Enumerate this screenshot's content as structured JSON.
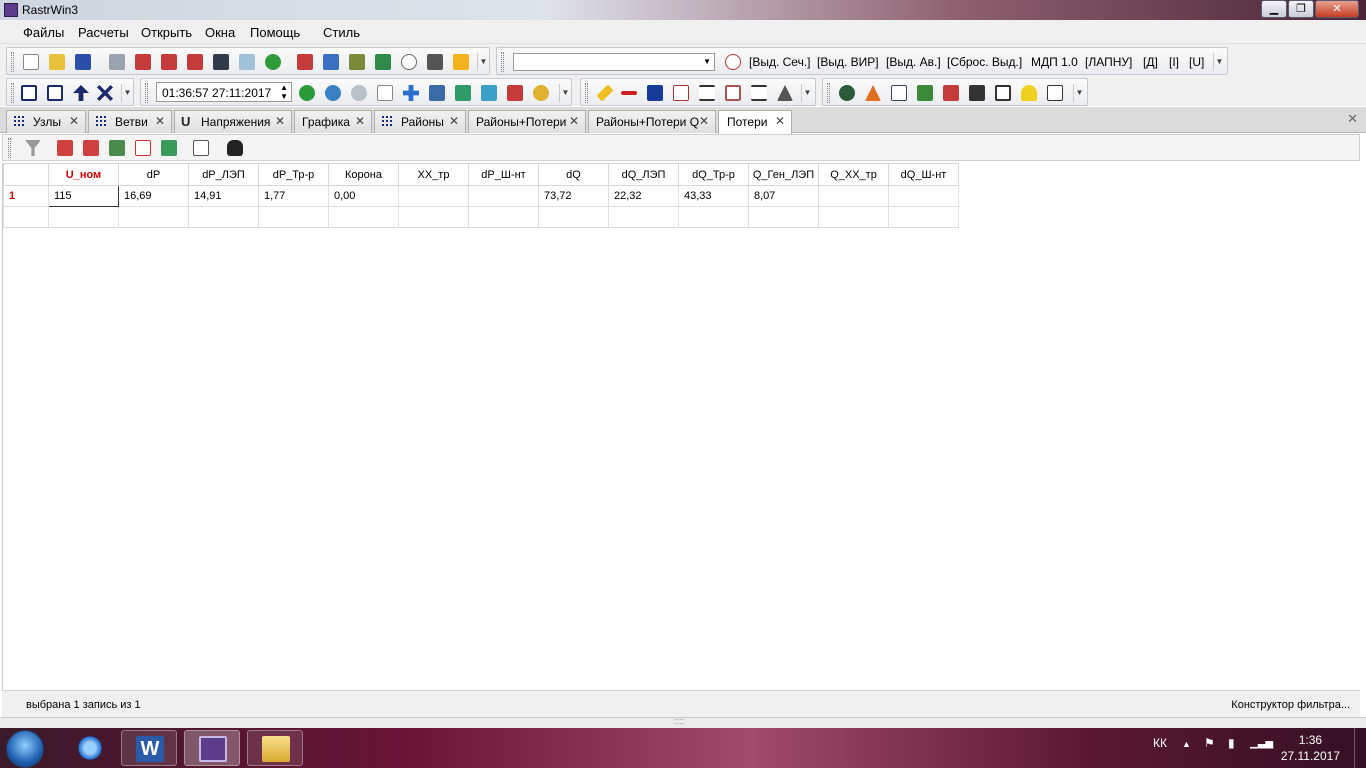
{
  "window": {
    "title": "RastrWin3"
  },
  "menu": [
    "Файлы",
    "Расчеты",
    "Открыть",
    "Окна",
    "Помощь",
    "Стиль"
  ],
  "toolbar1": {
    "combo_value": "",
    "text_buttons": [
      "[Выд. Сеч.]",
      "[Выд. ВИР]",
      "[Выд. Ав.]",
      "[Сброс. Выд.]",
      "МДП 1.0",
      "[ЛАПНУ]",
      "[Д]",
      "[I]",
      "[U]"
    ]
  },
  "toolbar2": {
    "datetime": "01:36:57  27:11:2017"
  },
  "tabs": [
    {
      "label": "Узлы",
      "icon": "grid-icon",
      "active": false
    },
    {
      "label": "Ветви",
      "icon": "branch-icon",
      "active": false
    },
    {
      "label": "Напряжения",
      "icon": "voltage-icon",
      "active": false
    },
    {
      "label": "Графика",
      "icon": "",
      "active": false
    },
    {
      "label": "Районы",
      "icon": "grid-icon",
      "active": false
    },
    {
      "label": "Районы+Потери",
      "icon": "",
      "active": false
    },
    {
      "label": "Районы+Потери Q",
      "icon": "",
      "active": false
    },
    {
      "label": "Потери",
      "icon": "",
      "active": true
    }
  ],
  "table": {
    "columns": [
      "U_ном",
      "dP",
      "dP_ЛЭП",
      "dP_Тр-р",
      "Корона",
      "XX_тр",
      "dP_Ш-нт",
      "dQ",
      "dQ_ЛЭП",
      "dQ_Тр-р",
      "Q_Ген_ЛЭП",
      "Q_XX_тр",
      "dQ_Ш-нт"
    ],
    "rows": [
      {
        "num": "1",
        "cells": [
          "115",
          "16,69",
          "14,91",
          "1,77",
          "0,00",
          "",
          "",
          "73,72",
          "22,32",
          "43,33",
          "8,07",
          "",
          ""
        ]
      }
    ]
  },
  "status": {
    "left": "выбрана 1 запись из 1",
    "right": "Конструктор фильтра..."
  },
  "taskbar": {
    "lang": "КК",
    "time": "1:36",
    "date": "27.11.2017"
  },
  "colors": {
    "accent_red": "#d00000",
    "tab_bg": "#dcdcdc",
    "toolbar_bg": "#f0f0f0"
  }
}
